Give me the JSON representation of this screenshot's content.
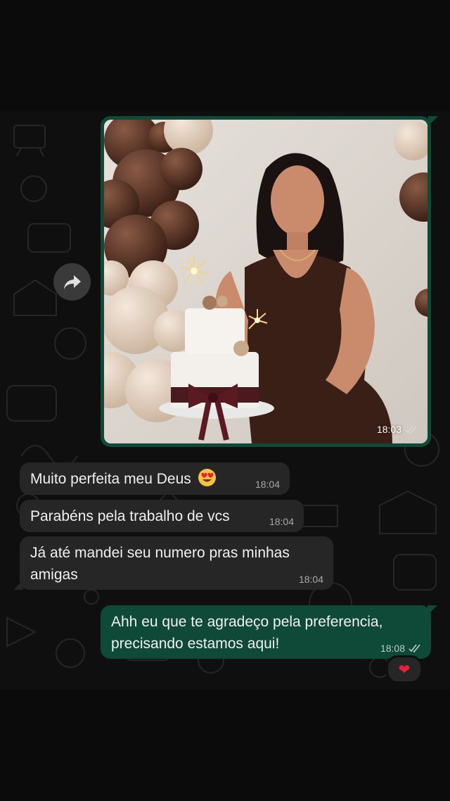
{
  "messages": {
    "image": {
      "time": "18:03",
      "status": "read-ticks-icon"
    },
    "msg1": {
      "text": "Muito perfeita meu Deus",
      "emoji": "heart-eyes-emoji",
      "time": "18:04"
    },
    "msg2": {
      "text": "Parabéns pela trabalho de vcs",
      "time": "18:04"
    },
    "msg3": {
      "text": "Já até mandei seu numero pras minhas amigas",
      "time": "18:04"
    },
    "msg4": {
      "text": "Ahh eu que te agradeço pela preferencia, precisando estamos aqui!",
      "time": "18:08",
      "status": "read-ticks-icon"
    },
    "reaction": {
      "emoji": "❤"
    }
  },
  "colors": {
    "incoming": "#262626",
    "outgoing": "#0f4a38",
    "background": "#0f0f0f"
  }
}
